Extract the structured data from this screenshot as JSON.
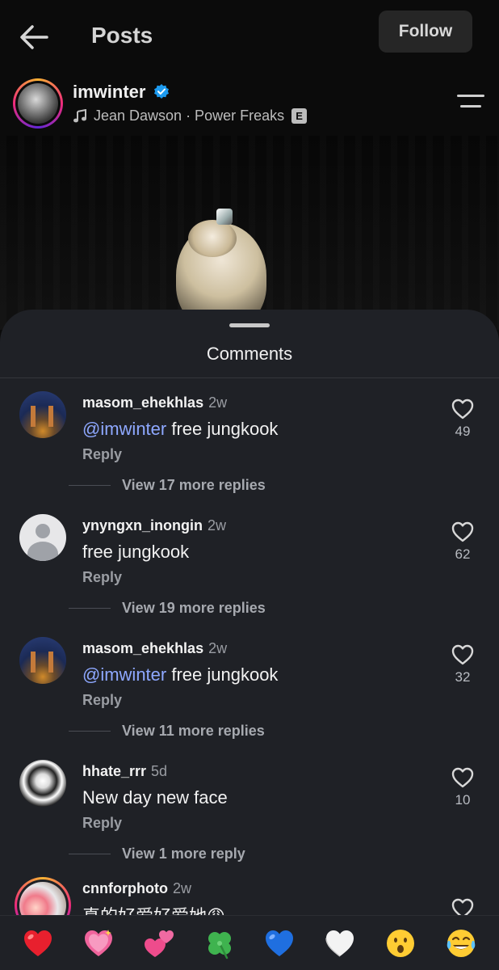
{
  "header": {
    "title": "Posts",
    "follow_label": "Follow",
    "back_icon": "back-arrow-icon"
  },
  "post": {
    "username": "imwinter",
    "verified": true,
    "song": "Jean Dawson · Power Freaks",
    "explicit_badge": "E"
  },
  "comments_sheet": {
    "title": "Comments",
    "comments": [
      {
        "username": "masom_ehekhlas",
        "time": "2w",
        "mention": "@imwinter",
        "text": " free jungkook",
        "reply_label": "Reply",
        "likes": "49",
        "more_replies": "View 17 more replies"
      },
      {
        "username": "ynyngxn_inongin",
        "time": "2w",
        "mention": "",
        "text": "free jungkook",
        "reply_label": "Reply",
        "likes": "62",
        "more_replies": "View 19 more replies"
      },
      {
        "username": "masom_ehekhlas",
        "time": "2w",
        "mention": "@imwinter",
        "text": " free jungkook",
        "reply_label": "Reply",
        "likes": "32",
        "more_replies": "View 11 more replies"
      },
      {
        "username": "hhate_rrr",
        "time": "5d",
        "mention": "",
        "text": "New day new face",
        "reply_label": "Reply",
        "likes": "10",
        "more_replies": "View 1 more reply"
      }
    ],
    "partial_comment": {
      "username": "cnnforphoto",
      "time": "2w",
      "text": "真的好爱好爱她😩"
    }
  },
  "emoji_bar": {
    "items": [
      "red-heart",
      "sparkling-heart",
      "two-hearts",
      "four-leaf-clover",
      "blue-heart",
      "white-heart",
      "surprised-face",
      "tears-of-joy"
    ]
  },
  "colors": {
    "mention": "#8ea8ff",
    "sheet_bg": "#1f2126",
    "verified": "#1d9bf0"
  }
}
